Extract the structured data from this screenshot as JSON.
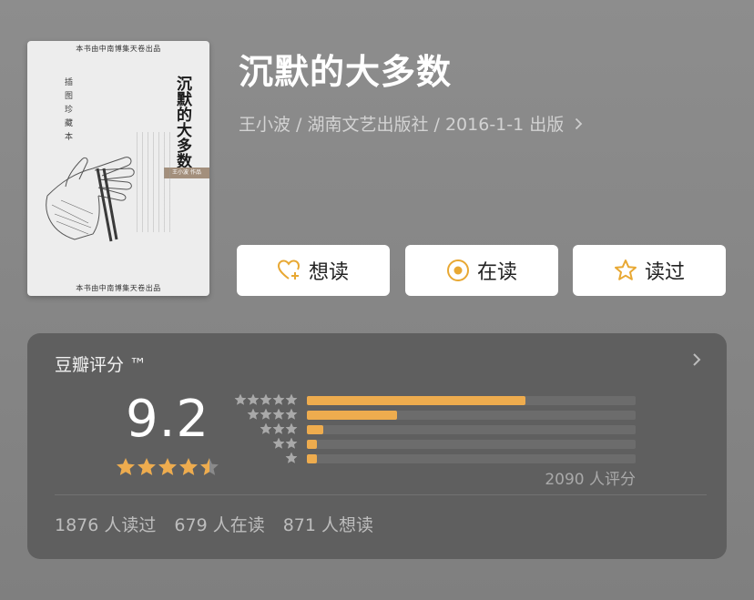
{
  "book": {
    "title": "沉默的大多数",
    "meta": "王小波 / 湖南文艺出版社 / 2016-1-1 出版",
    "cover": {
      "title": "沉默的大多数",
      "series": "插图珍藏本",
      "publisher_line": "本书由中南博集天卷出品",
      "strip": "王小波 作品"
    }
  },
  "actions": {
    "want_label": "想读",
    "reading_label": "在读",
    "read_label": "读过"
  },
  "rating": {
    "header": "豆瓣评分 ™",
    "score": "9.2",
    "stars": 4.5,
    "total_text": "2090 人评分",
    "distribution": [
      {
        "stars": 5,
        "fraction": 0.665
      },
      {
        "stars": 4,
        "fraction": 0.275
      },
      {
        "stars": 3,
        "fraction": 0.05
      },
      {
        "stars": 2,
        "fraction": 0.03
      },
      {
        "stars": 1,
        "fraction": 0.03
      }
    ]
  },
  "stats": {
    "read": "1876 人读过",
    "reading": "679 人在读",
    "want": "871 人想读"
  },
  "colors": {
    "accent": "#eeac4e",
    "card_bg": "#5f5f5f",
    "button_icon": "#e8a833"
  },
  "icons": {
    "want": "heart-plus-icon",
    "reading": "target-circle-icon",
    "read": "star-outline-icon",
    "more": "chevron-right-icon"
  }
}
